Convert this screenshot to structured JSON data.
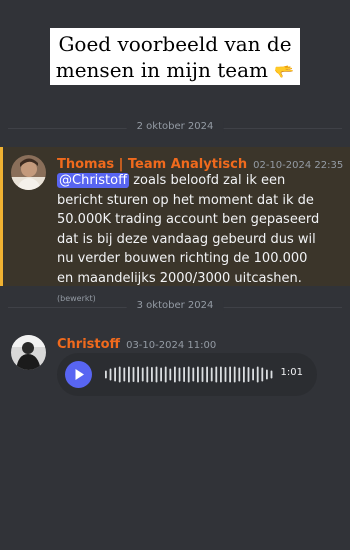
{
  "caption": {
    "line1": "Goed voorbeeld van de",
    "line2": "mensen in mijn team",
    "emoji": "🫳"
  },
  "dividers": [
    "2 oktober 2024",
    "3 oktober 2024"
  ],
  "messages": [
    {
      "author": "Thomas | Team Analytisch",
      "timestamp": "02-10-2024 22:35",
      "mention": "@Christoff",
      "text": " zoals beloofd zal ik een bericht sturen op het moment dat ik de 50.000K trading account ben gepaseerd dat is bij deze vandaag gebeurd dus wil nu verder bouwen richting de 100.000 en maandelijks 2000/3000 uitcashen.",
      "edited": "(bewerkt)",
      "highlighted": true
    },
    {
      "author": "Christoff",
      "timestamp": "03-10-2024 11:00",
      "voice_duration": "1:01"
    }
  ],
  "colors": {
    "background": "#313338",
    "author": "#f06a1d",
    "highlight_bar": "#f0b232",
    "mention": "#5865f2",
    "play_button": "#5865f2"
  },
  "icons": [
    "play-icon",
    "waveform-icon"
  ]
}
